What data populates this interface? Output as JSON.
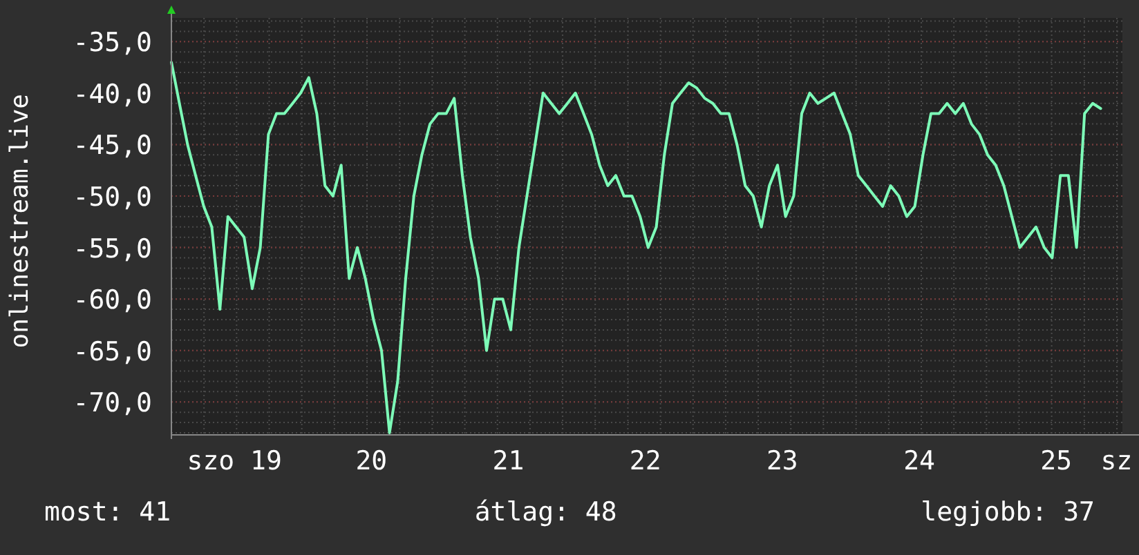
{
  "chart": {
    "chart_data": {
      "type": "line",
      "ylabel": "onlinestream.live",
      "grid": true,
      "xlim": [
        18.54,
        25.443
      ],
      "ylim": [
        -73.2,
        -32.7
      ],
      "x": [
        18.54,
        18.599,
        18.658,
        18.717,
        18.776,
        18.835,
        18.894,
        18.953,
        19.012,
        19.071,
        19.13,
        19.189,
        19.248,
        19.307,
        19.366,
        19.425,
        19.484,
        19.543,
        19.602,
        19.661,
        19.72,
        19.779,
        19.838,
        19.897,
        19.956,
        20.015,
        20.074,
        20.133,
        20.192,
        20.251,
        20.31,
        20.369,
        20.428,
        20.487,
        20.546,
        20.605,
        20.664,
        20.723,
        20.782,
        20.841,
        20.9,
        20.959,
        21.018,
        21.077,
        21.136,
        21.195,
        21.254,
        21.313,
        21.372,
        21.431,
        21.49,
        21.549,
        21.608,
        21.667,
        21.726,
        21.785,
        21.844,
        21.903,
        21.962,
        22.021,
        22.08,
        22.139,
        22.198,
        22.257,
        22.316,
        22.375,
        22.434,
        22.493,
        22.552,
        22.611,
        22.67,
        22.729,
        22.788,
        22.847,
        22.906,
        22.965,
        23.024,
        23.083,
        23.142,
        23.201,
        23.26,
        23.319,
        23.378,
        23.437,
        23.496,
        23.555,
        23.614,
        23.673,
        23.732,
        23.791,
        23.85,
        23.909,
        23.968,
        24.027,
        24.086,
        24.145,
        24.204,
        24.263,
        24.322,
        24.381,
        24.44,
        24.499,
        24.558,
        24.617,
        24.676,
        24.735,
        24.794,
        24.853,
        24.912,
        24.971,
        25.03,
        25.089,
        25.148,
        25.207,
        25.266,
        25.325
      ],
      "yticks": [
        {
          "value": -35,
          "label": "-35,0"
        },
        {
          "value": -40,
          "label": "-40,0"
        },
        {
          "value": -45,
          "label": "-45,0"
        },
        {
          "value": -50,
          "label": "-50,0"
        },
        {
          "value": -55,
          "label": "-55,0"
        },
        {
          "value": -60,
          "label": "-60,0"
        },
        {
          "value": -65,
          "label": "-65,0"
        },
        {
          "value": -70,
          "label": "-70,0"
        }
      ],
      "xticks": [
        {
          "value": 19,
          "label": "szo 19"
        },
        {
          "value": 20,
          "label": "20"
        },
        {
          "value": 21,
          "label": "21"
        },
        {
          "value": 22,
          "label": "22"
        },
        {
          "value": 23,
          "label": "23"
        },
        {
          "value": 24,
          "label": "24"
        },
        {
          "value": 25,
          "label": "25"
        },
        {
          "value": 25.44,
          "label": "sz"
        }
      ],
      "series": [
        {
          "color": "#7dfcb8",
          "values": [
            -37,
            -41,
            -45,
            -48,
            -51,
            -53,
            -61,
            -52,
            -53,
            -54,
            -59,
            -55,
            -44,
            -42,
            -42,
            -41,
            -40,
            -38.5,
            -42,
            -49,
            -50,
            -47,
            -58,
            -55,
            -58,
            -62,
            -65,
            -73,
            -68,
            -58,
            -50,
            -46,
            -43,
            -42,
            -42,
            -40.5,
            -48,
            -54,
            -58,
            -65,
            -60,
            -60,
            -63,
            -55,
            -50,
            -45,
            -40,
            -41,
            -42,
            -41,
            -40,
            -42,
            -44,
            -47,
            -49,
            -48,
            -50,
            -50,
            -52,
            -55,
            -53,
            -46,
            -41,
            -40,
            -39,
            -39.5,
            -40.5,
            -41,
            -42,
            -42,
            -45,
            -49,
            -50,
            -53,
            -49,
            -47,
            -52,
            -50,
            -42,
            -40,
            -41,
            -40.5,
            -40,
            -42,
            -44,
            -48,
            -49,
            -50,
            -51,
            -49,
            -50,
            -52,
            -51,
            -46,
            -42,
            -42,
            -41,
            -42,
            -41,
            -43,
            -44,
            -46,
            -47,
            -49,
            -52,
            -55,
            -54,
            -53,
            -55,
            -56,
            -48,
            -48,
            -55,
            -42,
            -41,
            -41.5
          ]
        }
      ]
    }
  },
  "stats": [
    "most: 41",
    "átlag: 48",
    "legjobb: 37"
  ]
}
